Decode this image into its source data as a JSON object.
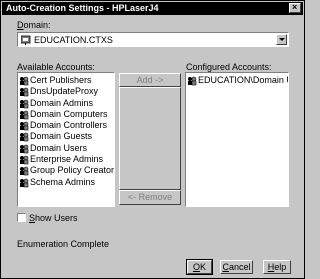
{
  "window": {
    "title": "Auto-Creation Settings - HPLaserJ4",
    "close": "×"
  },
  "domain": {
    "label_prefix": "",
    "label_hot": "D",
    "label_rest": "omain:",
    "value": "EDUCATION.CTXS"
  },
  "available": {
    "label": "Available Accounts:",
    "items": [
      "Cert Publishers",
      "DnsUpdateProxy",
      "Domain Admins",
      "Domain Computers",
      "Domain Controllers",
      "Domain Guests",
      "Domain Users",
      "Enterprise Admins",
      "Group Policy Creator Owne",
      "Schema Admins"
    ]
  },
  "configured": {
    "label": "Configured Accounts:",
    "items": [
      "EDUCATION\\Domain Users"
    ]
  },
  "buttons": {
    "add": "Add ->",
    "remove": "<- Remove",
    "ok_hot": "O",
    "ok_rest": "K",
    "cancel_hot": "C",
    "cancel_rest": "ancel",
    "help_hot": "H",
    "help_rest": "elp"
  },
  "show_users": {
    "hot": "S",
    "rest": "how Users"
  },
  "status": "Enumeration Complete",
  "icons": {
    "group": "group-icon",
    "domain": "domain-icon"
  }
}
